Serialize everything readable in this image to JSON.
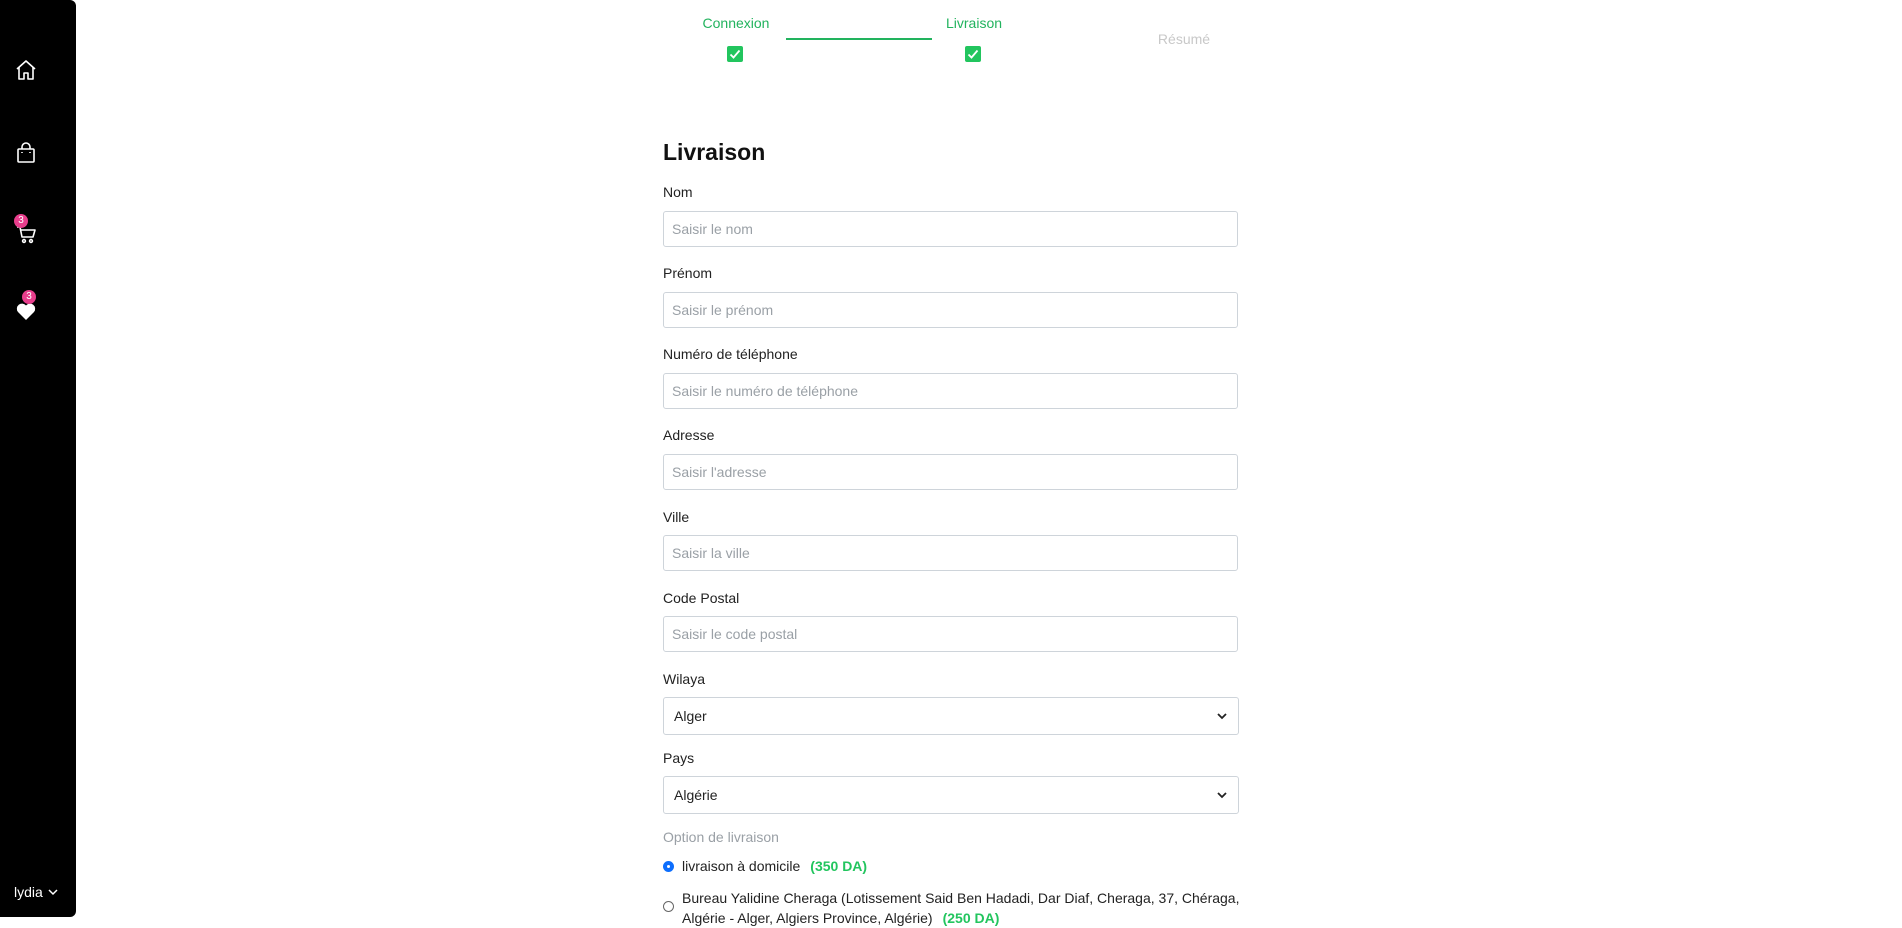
{
  "sidebar": {
    "icons": [
      "home-icon",
      "shopping-bag-icon",
      "cart-icon",
      "heart-icon"
    ],
    "cart_badge": "3",
    "wishlist_badge": "3",
    "user_name": "lydia"
  },
  "stepper": {
    "steps": [
      {
        "label": "Connexion",
        "done": true
      },
      {
        "label": "Livraison",
        "done": true
      },
      {
        "label": "Résumé",
        "done": false
      }
    ],
    "accent_color": "#22b35e"
  },
  "form": {
    "title": "Livraison",
    "fields": {
      "nom": {
        "label": "Nom",
        "placeholder": "Saisir le nom",
        "value": ""
      },
      "prenom": {
        "label": "Prénom",
        "placeholder": "Saisir le prénom",
        "value": ""
      },
      "telephone": {
        "label": "Numéro de téléphone",
        "placeholder": "Saisir le numéro de téléphone",
        "value": ""
      },
      "adresse": {
        "label": "Adresse",
        "placeholder": "Saisir l'adresse",
        "value": ""
      },
      "ville": {
        "label": "Ville",
        "placeholder": "Saisir la ville",
        "value": ""
      },
      "code_postal": {
        "label": "Code Postal",
        "placeholder": "Saisir le code postal",
        "value": ""
      }
    },
    "wilaya": {
      "label": "Wilaya",
      "selected": "Alger"
    },
    "pays": {
      "label": "Pays",
      "selected": "Algérie"
    },
    "delivery": {
      "title": "Option de livraison",
      "options": [
        {
          "label": "livraison à domicile",
          "price": "(350 DA)",
          "selected": true
        },
        {
          "label": "Bureau Yalidine Cheraga (Lotissement Said Ben Hadadi, Dar Diaf, Cheraga, 37, Chéraga, Algérie - Alger, Algiers Province, Algérie)",
          "price": "(250 DA)",
          "selected": false
        }
      ]
    }
  }
}
